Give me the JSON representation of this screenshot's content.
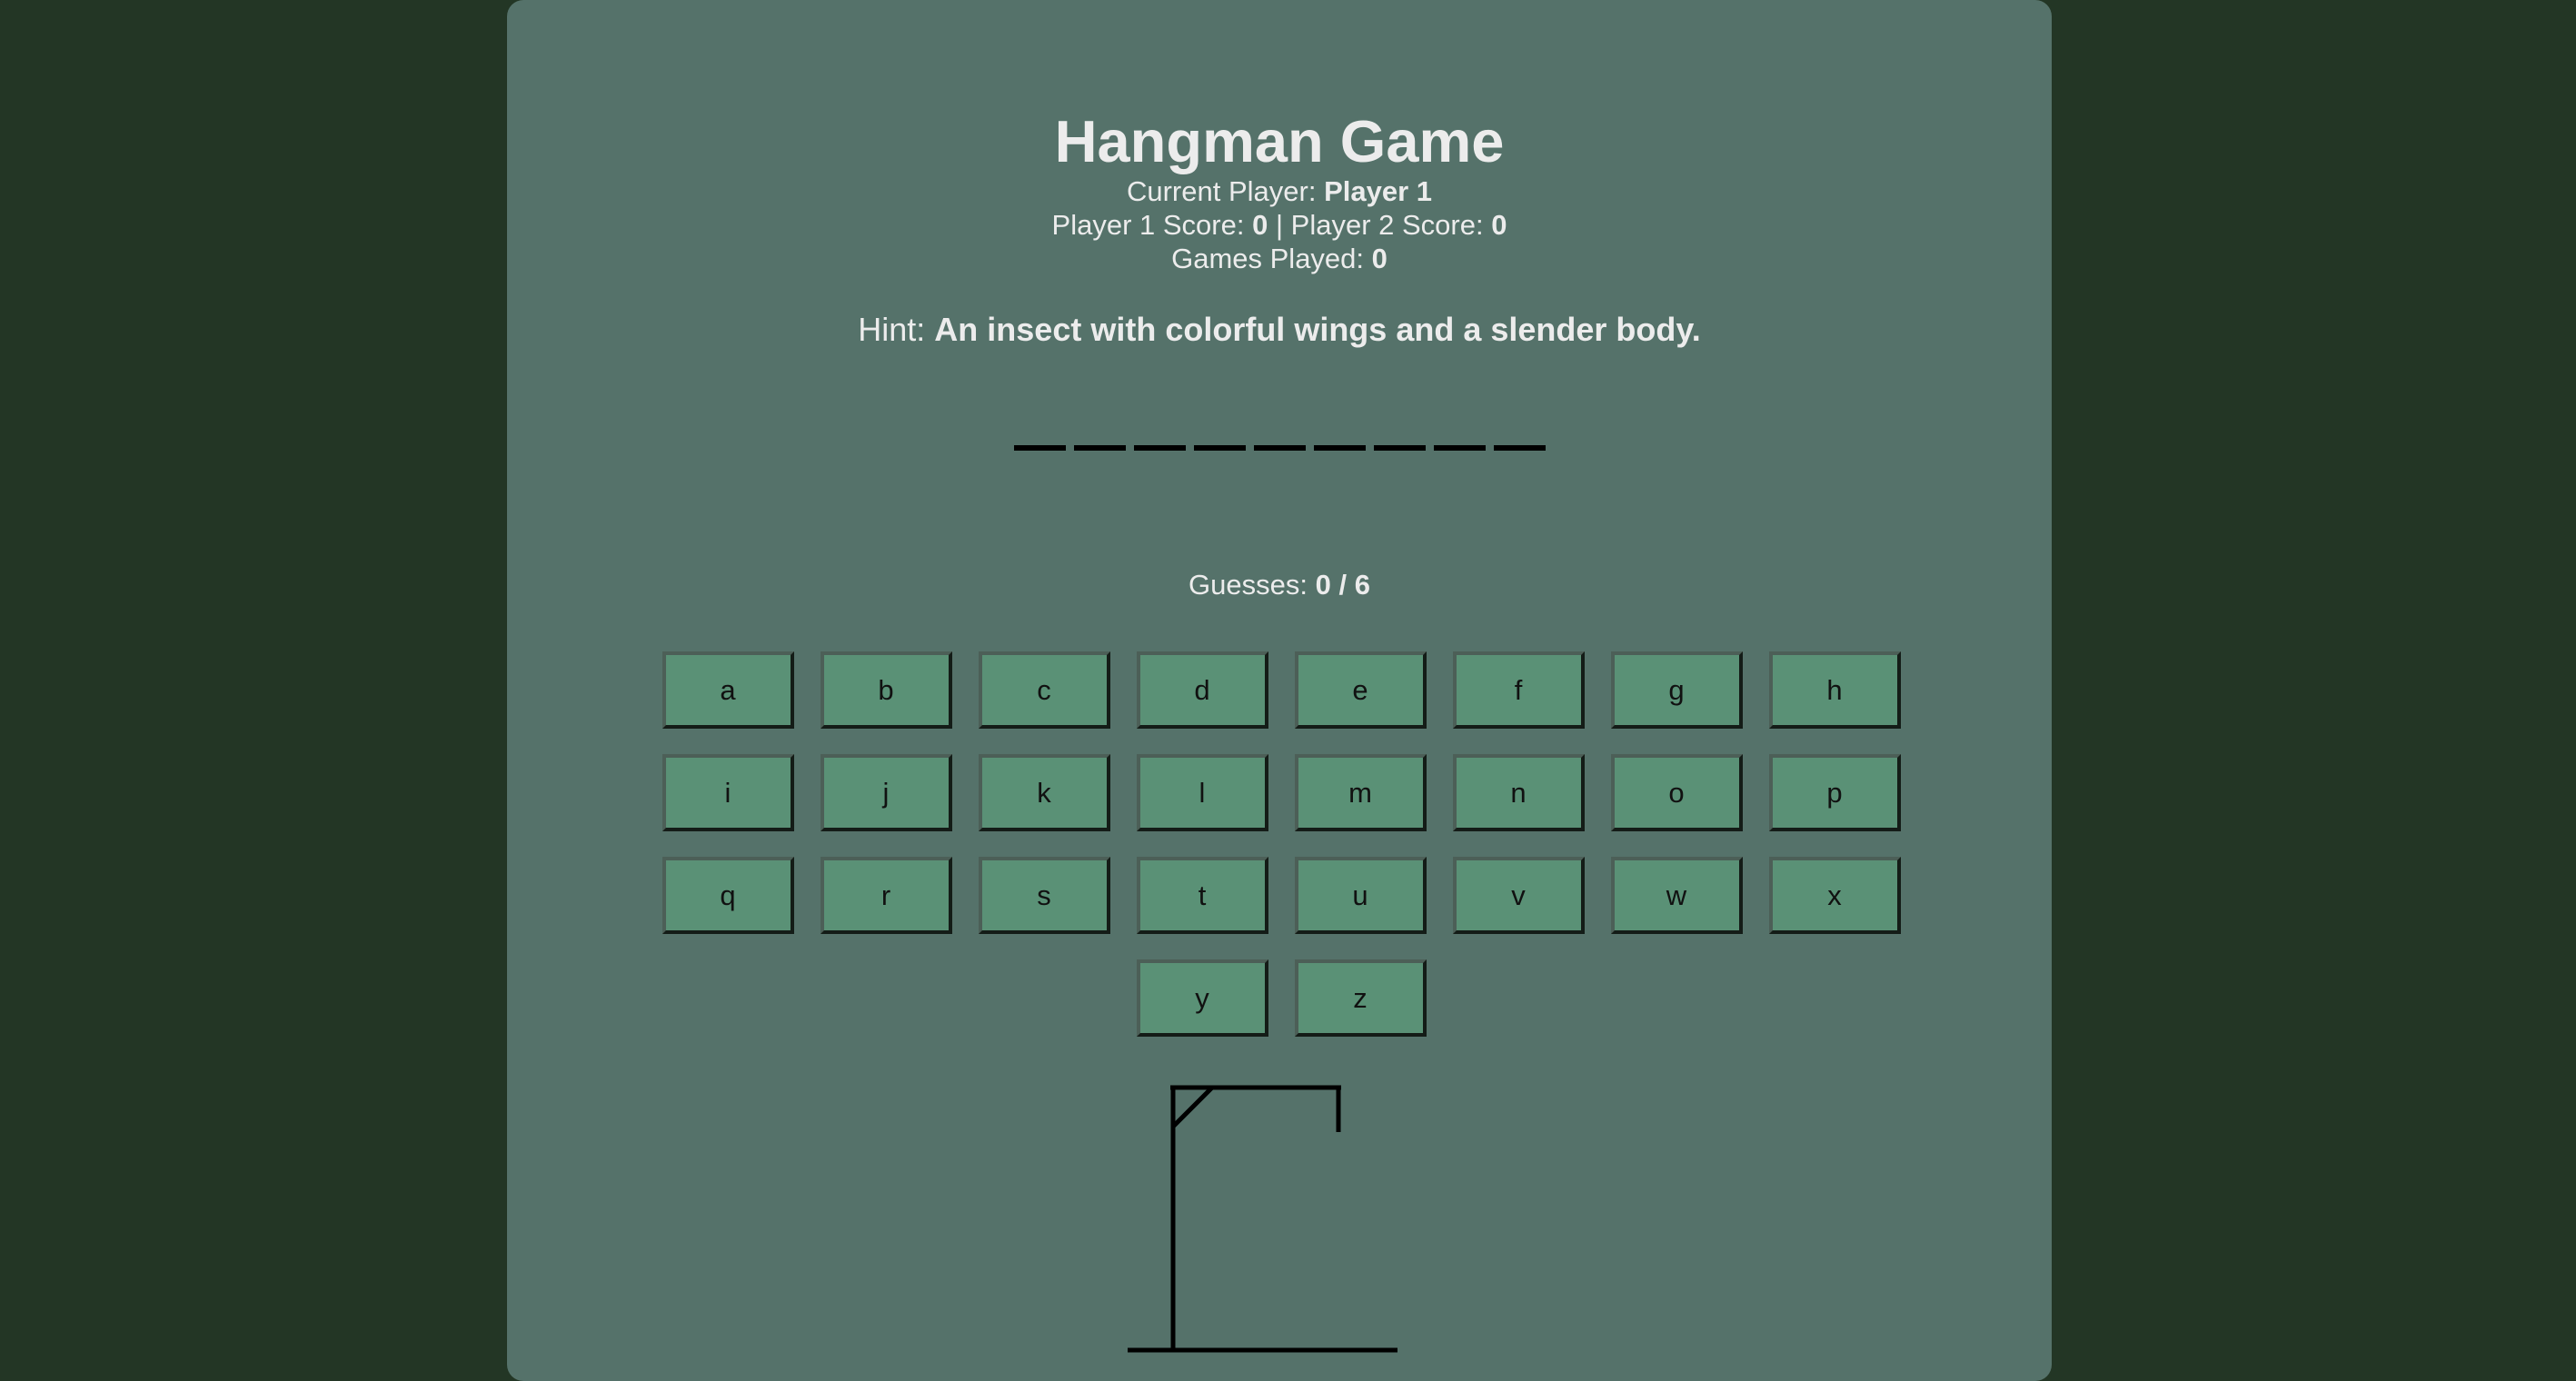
{
  "title": "Hangman Game",
  "current_player": {
    "label": "Current Player:",
    "value": "Player 1"
  },
  "scores": {
    "p1_label": "Player 1 Score:",
    "p1_value": "0",
    "separator": "|",
    "p2_label": "Player 2 Score:",
    "p2_value": "0"
  },
  "games_played": {
    "label": "Games Played:",
    "value": "0"
  },
  "hint": {
    "label": "Hint:",
    "value": "An insect with colorful wings and a slender body."
  },
  "word": {
    "revealed": [
      "",
      "",
      "",
      "",
      "",
      "",
      "",
      "",
      ""
    ]
  },
  "guesses": {
    "label": "Guesses:",
    "value": "0 / 6"
  },
  "keys": [
    "a",
    "b",
    "c",
    "d",
    "e",
    "f",
    "g",
    "h",
    "i",
    "j",
    "k",
    "l",
    "m",
    "n",
    "o",
    "p",
    "q",
    "r",
    "s",
    "t",
    "u",
    "v",
    "w",
    "x",
    "y",
    "z"
  ],
  "colors": {
    "background": "#233625",
    "panel": "#55726a",
    "key": "#5a9176",
    "text": "#ececec"
  }
}
